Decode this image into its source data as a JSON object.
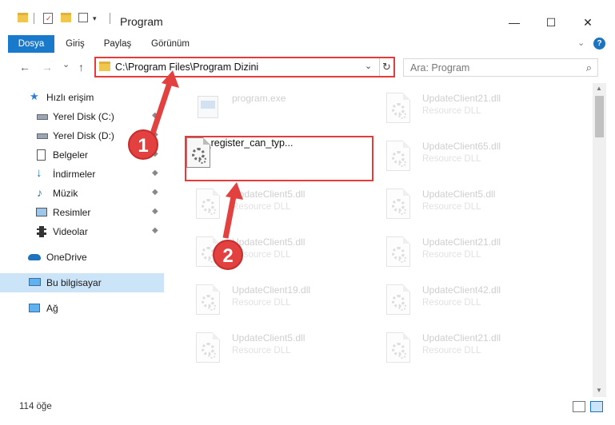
{
  "window": {
    "title": "Program",
    "minimize": "—",
    "maximize": "☐",
    "close": "✕"
  },
  "ribbon": {
    "tabs": [
      {
        "label": "Dosya",
        "active": true
      },
      {
        "label": "Giriş"
      },
      {
        "label": "Paylaş"
      },
      {
        "label": "Görünüm"
      }
    ],
    "collapse": "⌄",
    "help": "?"
  },
  "navigation": {
    "back": "←",
    "forward": "→",
    "recent": "⌄",
    "up": "↑"
  },
  "address": {
    "path": "C:\\Program Files\\Program Dizini",
    "dropdown": "⌄",
    "refresh": "↻"
  },
  "search": {
    "placeholder": "Ara: Program",
    "icon": "⌕"
  },
  "sidebar": {
    "items": [
      {
        "label": "Hızlı erişim",
        "icon": "star-icon"
      },
      {
        "label": "Yerel Disk (C:)",
        "icon": "drive-icon",
        "pin": "📌"
      },
      {
        "label": "Yerel Disk (D:)",
        "icon": "drive-icon",
        "pin": "📌"
      },
      {
        "label": "Belgeler",
        "icon": "documents-icon",
        "pin": "📌"
      },
      {
        "label": "İndirmeler",
        "icon": "download-icon",
        "pin": "📌"
      },
      {
        "label": "Müzik",
        "icon": "music-icon",
        "pin": "📌"
      },
      {
        "label": "Resimler",
        "icon": "pictures-icon",
        "pin": "📌"
      },
      {
        "label": "Videolar",
        "icon": "videos-icon",
        "pin": "📌"
      },
      {
        "label": "OneDrive",
        "icon": "cloud-icon"
      },
      {
        "label": "Bu bilgisayar",
        "icon": "computer-icon",
        "selected": true
      },
      {
        "label": "Ağ",
        "icon": "network-icon"
      }
    ]
  },
  "files": {
    "left": [
      {
        "name": "program.exe",
        "type": ""
      },
      {
        "name": "sfun_register_can_typ...",
        "type": ""
      },
      {
        "name": "UpdateClient5.dll",
        "type": "Resource DLL"
      },
      {
        "name": "UpdateClient5.dll",
        "type": "Resource DLL"
      },
      {
        "name": "UpdateClient19.dll",
        "type": "Resource DLL"
      },
      {
        "name": "UpdateClient5.dll",
        "type": "Resource DLL"
      }
    ],
    "right": [
      {
        "name": "UpdateClient21.dll",
        "type": "Resource DLL"
      },
      {
        "name": "UpdateClient65.dll",
        "type": "Resource DLL"
      },
      {
        "name": "UpdateClient5.dll",
        "type": "Resource DLL"
      },
      {
        "name": "UpdateClient21.dll",
        "type": "Resource DLL"
      },
      {
        "name": "UpdateClient42.dll",
        "type": "Resource DLL"
      },
      {
        "name": "UpdateClient21.dll",
        "type": "Resource DLL"
      }
    ]
  },
  "status": {
    "count": "114 öğe"
  },
  "callouts": {
    "one": "1",
    "two": "2"
  },
  "colors": {
    "accent": "#1979ca",
    "highlight": "#e53b3b",
    "selected": "#cce4f7"
  }
}
